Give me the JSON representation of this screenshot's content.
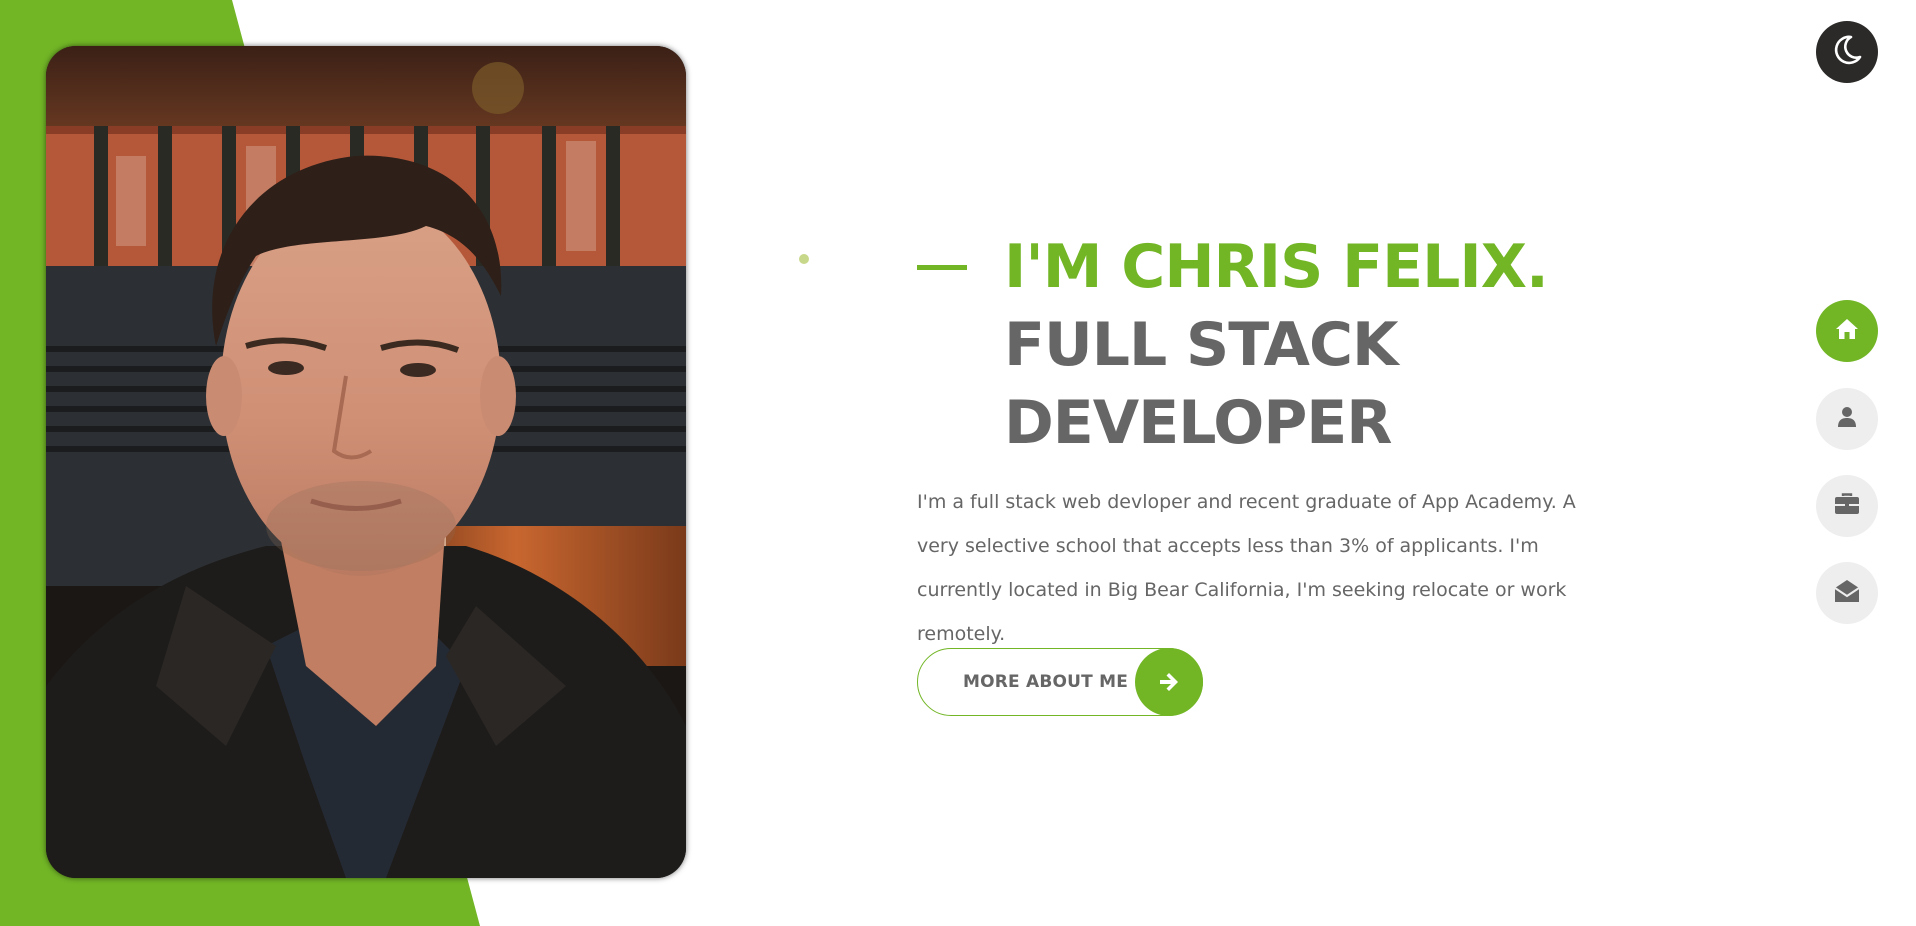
{
  "colors": {
    "accent": "#72b626",
    "heading_gray": "#666666",
    "text_gray": "#666666",
    "nav_inactive_bg": "#eeeeee",
    "toggle_bg": "#2b2a29",
    "background": "#ffffff"
  },
  "hero": {
    "name_line": "I'M CHRIS FELIX.",
    "role_line_1": "FULL STACK",
    "role_line_2": "DEVELOPER",
    "intro": "I'm a full stack web devloper and recent graduate of App Academy. A very selective school that accepts less than 3% of applicants. I'm currently located in Big Bear California, I'm seeking relocate or work remotely.",
    "cta_label": "MORE ABOUT ME",
    "cta_icon": "arrow-right-icon",
    "photo": "portrait-photo"
  },
  "theme_toggle": {
    "icon": "moon-icon"
  },
  "side_nav": {
    "items": [
      {
        "icon": "home-icon",
        "active": true
      },
      {
        "icon": "user-icon",
        "active": false
      },
      {
        "icon": "briefcase-icon",
        "active": false
      },
      {
        "icon": "envelope-open-icon",
        "active": false
      }
    ]
  }
}
